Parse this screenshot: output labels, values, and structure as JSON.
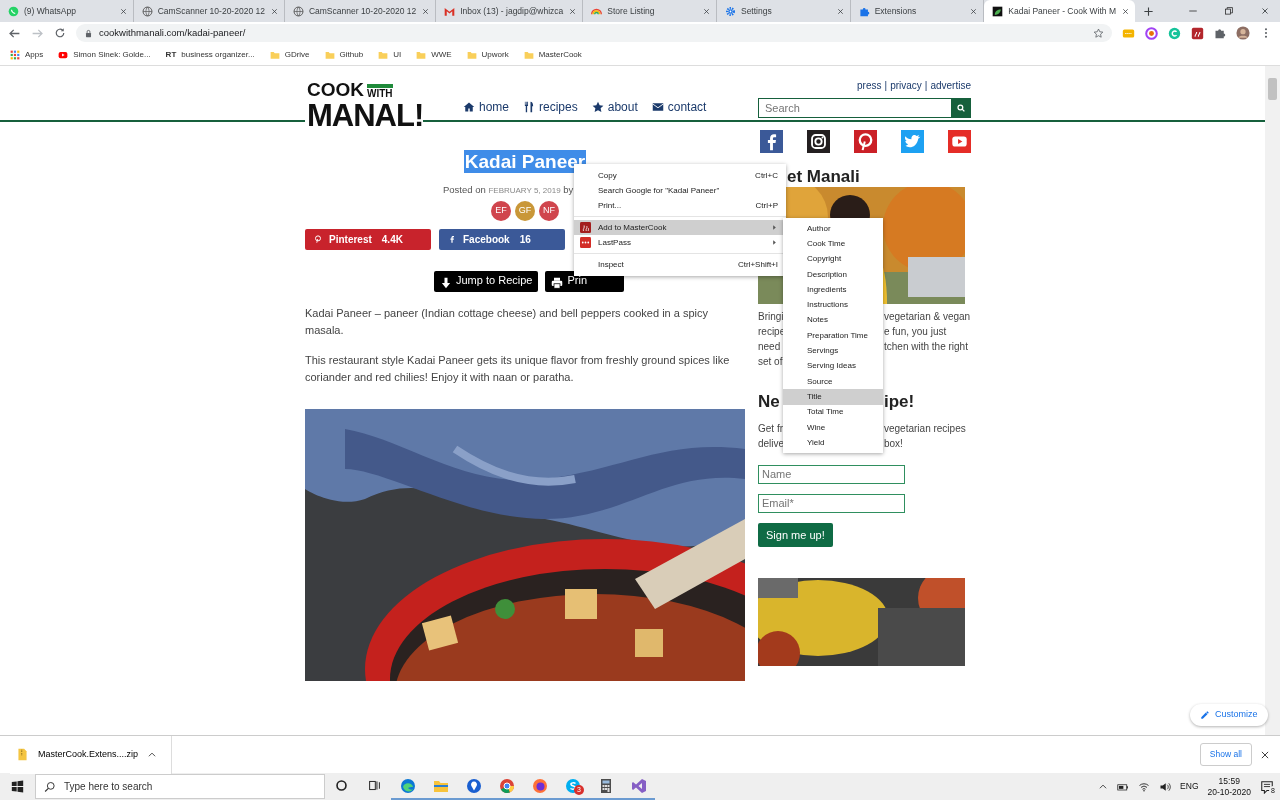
{
  "browser": {
    "tabs": [
      {
        "title": "(9) WhatsApp",
        "kind": "whatsapp",
        "selected": false
      },
      {
        "title": "CamScanner 10-20-2020 12",
        "kind": "globe",
        "selected": false
      },
      {
        "title": "CamScanner 10-20-2020 12",
        "kind": "globe",
        "selected": false
      },
      {
        "title": "Inbox (13) - jagdip@whizca",
        "kind": "gmail",
        "selected": false
      },
      {
        "title": "Store Listing",
        "kind": "rainbow",
        "selected": false
      },
      {
        "title": "Settings",
        "kind": "gear",
        "selected": false
      },
      {
        "title": "Extensions",
        "kind": "puzzle",
        "selected": false
      },
      {
        "title": "Kadai Paneer - Cook With M",
        "kind": "site",
        "selected": true
      }
    ],
    "url": "cookwithmanali.com/kadai-paneer/",
    "bookmarks": [
      {
        "kind": "apps",
        "label": "Apps"
      },
      {
        "kind": "video",
        "label": "Simon Sinek: Golde..."
      },
      {
        "kind": "text",
        "prefix": "RT",
        "label": "business organizer..."
      },
      {
        "kind": "folder",
        "label": "GDrive"
      },
      {
        "kind": "folder",
        "label": "Github"
      },
      {
        "kind": "folder",
        "label": "UI"
      },
      {
        "kind": "folder",
        "label": "WWE"
      },
      {
        "kind": "folder",
        "label": "Upwork"
      },
      {
        "kind": "folder",
        "label": "MasterCook"
      }
    ]
  },
  "site": {
    "logo": {
      "top": "COOK",
      "small": "WITH",
      "bottom": "MANAL!"
    },
    "top_links": [
      "press",
      "privacy",
      "advertise"
    ],
    "link_separator": "|",
    "nav": [
      {
        "kind": "home",
        "label": "home"
      },
      {
        "kind": "recipes",
        "label": "recipes"
      },
      {
        "kind": "star",
        "label": "about"
      },
      {
        "kind": "envelope",
        "label": "contact"
      }
    ],
    "search": {
      "placeholder": "Search"
    },
    "social": [
      {
        "kind": "facebook",
        "color": "#3b5998"
      },
      {
        "kind": "instagram",
        "color": "#231f20"
      },
      {
        "kind": "pinterest",
        "color": "#cb2027"
      },
      {
        "kind": "twitter",
        "color": "#1da1f2"
      },
      {
        "kind": "youtube",
        "color": "#e52d27"
      }
    ],
    "post": {
      "title": "Kadai Paneer",
      "title_selected": true,
      "posted_on": "Posted on",
      "date": "FEBRUARY 5, 2019",
      "by": "by",
      "diet_tags": [
        {
          "label": "EF",
          "color": "#d0454d"
        },
        {
          "label": "GF",
          "color": "#c99738"
        },
        {
          "label": "NF",
          "color": "#d0454d"
        }
      ],
      "shares": [
        {
          "kind": "pinterest",
          "label": "Pinterest",
          "count": "4.4K",
          "color": "#c8232c"
        },
        {
          "kind": "facebook",
          "label": "Facebook",
          "count": "16",
          "color": "#3b5998"
        }
      ],
      "actions": [
        {
          "kind": "down",
          "label": "Jump to Recipe"
        },
        {
          "kind": "print",
          "label": "Prin"
        }
      ],
      "paragraphs": [
        "Kadai Paneer – paneer (Indian cottage cheese) and bell peppers cooked in a spicy masala.",
        "This restaurant style Kadai Paneer gets its unique flavor from freshly ground spices like coriander and red chilies! Enjoy it with naan or paratha."
      ]
    },
    "sidebar": {
      "about_heading": "et Manali",
      "about_lines": [
        [
          "Bringi",
          "vegetarian & vegan"
        ],
        [
          "recipe",
          "e fun, you just"
        ],
        [
          "need",
          "tchen with the right"
        ],
        [
          "set of"
        ]
      ],
      "newsletter_heading": [
        "Ne",
        "ipe!"
      ],
      "newsletter_lines": [
        [
          "Get fr",
          "vegetarian recipes"
        ],
        [
          "delive",
          "box!"
        ]
      ],
      "fields": [
        {
          "placeholder": "Name"
        },
        {
          "placeholder": "Email*"
        }
      ],
      "submit": "Sign me up!"
    },
    "customize": "Customize"
  },
  "context_menu": {
    "groups": [
      [
        {
          "label": "Copy",
          "shortcut": "Ctrl+C",
          "selected": false
        },
        {
          "label": "Search Google for \"Kadai Paneer\"",
          "selected": false
        },
        {
          "label": "Print...",
          "shortcut": "Ctrl+P",
          "selected": false
        }
      ],
      [
        {
          "label": "Add to MasterCook",
          "kind": "mastercook",
          "submenu": true,
          "selected": true
        },
        {
          "label": "LastPass",
          "kind": "lastpass",
          "submenu": true,
          "selected": false
        }
      ],
      [
        {
          "label": "Inspect",
          "shortcut": "Ctrl+Shift+I",
          "selected": false
        }
      ]
    ],
    "submenu": [
      {
        "label": "Author",
        "selected": false
      },
      {
        "label": "Cook Time",
        "selected": false
      },
      {
        "label": "Copyright",
        "selected": false
      },
      {
        "label": "Description",
        "selected": false
      },
      {
        "label": "Ingredients",
        "selected": false
      },
      {
        "label": "Instructions",
        "selected": false
      },
      {
        "label": "Notes",
        "selected": false
      },
      {
        "label": "Preparation Time",
        "selected": false
      },
      {
        "label": "Servings",
        "selected": false
      },
      {
        "label": "Serving Ideas",
        "selected": false
      },
      {
        "label": "Source",
        "selected": false
      },
      {
        "label": "Title",
        "selected": true
      },
      {
        "label": "Total Time",
        "selected": false
      },
      {
        "label": "Wine",
        "selected": false
      },
      {
        "label": "Yield",
        "selected": false
      }
    ]
  },
  "downloads": {
    "file": "MasterCook.Extens....zip",
    "show_all": "Show all"
  },
  "taskbar": {
    "search_placeholder": "Type here to search",
    "apps": [
      {
        "kind": "edge",
        "running": true
      },
      {
        "kind": "explorer",
        "running": true
      },
      {
        "kind": "maps",
        "running": true
      },
      {
        "kind": "chrome",
        "running": true
      },
      {
        "kind": "firefox",
        "running": true
      },
      {
        "kind": "skype",
        "running": true,
        "badge": "3"
      },
      {
        "kind": "calculator",
        "running": true
      },
      {
        "kind": "studio",
        "running": true
      }
    ],
    "language": "ENG",
    "time": "15:59",
    "date": "20-10-2020",
    "notifications": "8"
  }
}
